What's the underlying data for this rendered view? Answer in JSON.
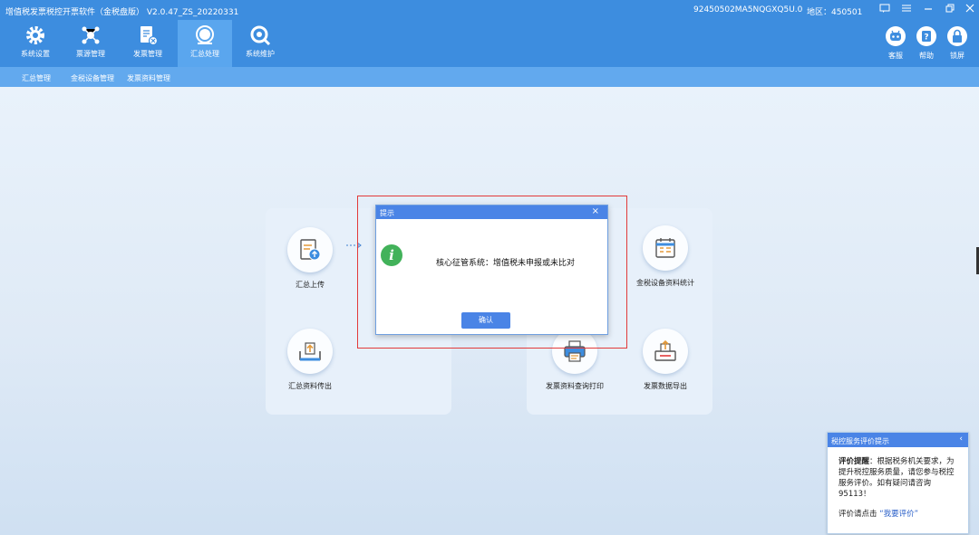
{
  "titlebar": {
    "app_title": "增值税发票税控开票软件（金税盘版） V2.0.47_ZS_20220331",
    "tax_id": "92450502MA5NQGXQ5U.0",
    "region": "地区：450501"
  },
  "nav": [
    {
      "label": "系统设置",
      "icon": "gear-icon"
    },
    {
      "label": "票源管理",
      "icon": "network-icon"
    },
    {
      "label": "发票管理",
      "icon": "invoice-icon"
    },
    {
      "label": "汇总处理",
      "icon": "summary-icon"
    },
    {
      "label": "系统维护",
      "icon": "wrench-icon"
    }
  ],
  "right_buttons": [
    {
      "label": "客服",
      "icon": "robot-icon"
    },
    {
      "label": "帮助",
      "icon": "help-icon"
    },
    {
      "label": "锁屏",
      "icon": "lock-icon"
    }
  ],
  "subnav": [
    "汇总管理",
    "金税设备管理",
    "发票资料管理"
  ],
  "features": [
    {
      "label": "汇总上传",
      "icon": "upload-doc-icon"
    },
    {
      "label": "汇总资料传出",
      "icon": "tray-upload-icon"
    },
    {
      "label": "金税设备资料统计",
      "icon": "calendar-icon"
    },
    {
      "label": "发票资料查询打印",
      "icon": "printer-icon"
    },
    {
      "label": "发票数据导出",
      "icon": "export-icon"
    }
  ],
  "dialog": {
    "title": "提示",
    "message": "核心征管系统：增值税未申报或未比对",
    "ok_label": "确认"
  },
  "notice": {
    "title": "税控服务评价提示",
    "bold_lead": "评价提醒",
    "body": "：根据税务机关要求，为提升税控服务质量，请您参与税控服务评价。如有疑问请咨询95113！",
    "footer_prefix": "评价请点击",
    "footer_link": "“我要评价”"
  },
  "colors": {
    "accent": "#3d8ddf",
    "dialog_header": "#4a84e6",
    "info_green": "#42b25a",
    "highlight_red": "#e23a3a"
  }
}
